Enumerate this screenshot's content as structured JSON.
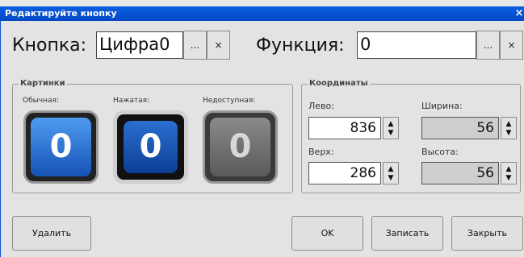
{
  "window": {
    "title": "Редактируйте кнопку",
    "close_label": "×"
  },
  "button_row": {
    "button_label": "Кнопка:",
    "button_value": "Цифра0",
    "function_label": "Функция:",
    "function_value": "0",
    "browse_label": "...",
    "clear_label": "×"
  },
  "images_group": {
    "title": "Картинки",
    "normal_label": "Обычная:",
    "pressed_label": "Нажатая:",
    "disabled_label": "Недоступная:",
    "digit": "0"
  },
  "coords_group": {
    "title": "Координаты",
    "left_label": "Лево:",
    "left_value": "836",
    "width_label": "Ширина:",
    "width_value": "56",
    "top_label": "Верх:",
    "top_value": "286",
    "height_label": "Высота:",
    "height_value": "56",
    "spin_up": "▲",
    "spin_down": "▼"
  },
  "actions": {
    "delete_label": "Удалить",
    "ok_label": "OK",
    "save_label": "Записать",
    "close_label": "Закрыть"
  },
  "colors": {
    "title_bar": "#0a5fe0",
    "dialog_bg": "#e3e3e3",
    "button_blue": "#1c63c8"
  }
}
